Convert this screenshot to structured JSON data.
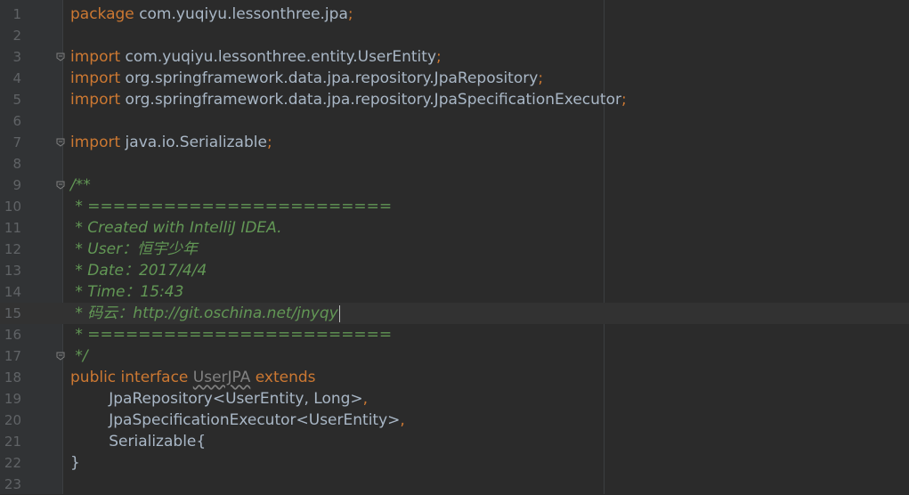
{
  "editor": {
    "lines": [
      {
        "n": "1",
        "parts": [
          [
            "kw",
            "package "
          ],
          [
            "pk",
            "com.yuqiyu.lessonthree.jpa"
          ],
          [
            "kw",
            ";"
          ]
        ]
      },
      {
        "n": "2",
        "parts": []
      },
      {
        "n": "3",
        "fold": true,
        "parts": [
          [
            "kw",
            "import "
          ],
          [
            "pk",
            "com.yuqiyu.lessonthree.entity.UserEntity"
          ],
          [
            "kw",
            ";"
          ]
        ]
      },
      {
        "n": "4",
        "parts": [
          [
            "kw",
            "import "
          ],
          [
            "pk",
            "org.springframework.data.jpa.repository.JpaRepository"
          ],
          [
            "kw",
            ";"
          ]
        ]
      },
      {
        "n": "5",
        "parts": [
          [
            "kw",
            "import "
          ],
          [
            "pk",
            "org.springframework.data.jpa.repository.JpaSpecificationExecutor"
          ],
          [
            "kw",
            ";"
          ]
        ]
      },
      {
        "n": "6",
        "parts": []
      },
      {
        "n": "7",
        "fold": true,
        "parts": [
          [
            "kw",
            "import "
          ],
          [
            "pk",
            "java.io.Serializable"
          ],
          [
            "kw",
            ";"
          ]
        ]
      },
      {
        "n": "8",
        "parts": []
      },
      {
        "n": "9",
        "fold": true,
        "parts": [
          [
            "cm",
            "/**"
          ]
        ]
      },
      {
        "n": "10",
        "parts": [
          [
            "cm",
            " * ========================"
          ]
        ]
      },
      {
        "n": "11",
        "parts": [
          [
            "cm",
            " * Created with IntelliJ IDEA."
          ]
        ]
      },
      {
        "n": "12",
        "parts": [
          [
            "cm",
            " * User：恒宇少年"
          ]
        ]
      },
      {
        "n": "13",
        "parts": [
          [
            "cm",
            " * Date：2017/4/4"
          ]
        ]
      },
      {
        "n": "14",
        "parts": [
          [
            "cm",
            " * Time：15:43"
          ]
        ]
      },
      {
        "n": "15",
        "current": true,
        "parts": [
          [
            "cm",
            " * 码云：http://git.oschina.net/jnyqy"
          ]
        ]
      },
      {
        "n": "16",
        "parts": [
          [
            "cm",
            " * ========================"
          ]
        ]
      },
      {
        "n": "17",
        "fold": true,
        "parts": [
          [
            "cm",
            " */"
          ]
        ]
      },
      {
        "n": "18",
        "parts": [
          [
            "kw",
            "public interface "
          ],
          [
            "dim squiggle",
            "UserJPA"
          ],
          [
            "kw",
            " extends"
          ]
        ]
      },
      {
        "n": "19",
        "parts": [
          [
            "pk",
            "        JpaRepository<UserEntity, Long>"
          ],
          [
            "kw",
            ","
          ]
        ]
      },
      {
        "n": "20",
        "parts": [
          [
            "pk",
            "        JpaSpecificationExecutor<UserEntity>"
          ],
          [
            "kw",
            ","
          ]
        ]
      },
      {
        "n": "21",
        "parts": [
          [
            "pk",
            "        Serializable{"
          ]
        ]
      },
      {
        "n": "22",
        "parts": [
          [
            "pk",
            "}"
          ]
        ]
      },
      {
        "n": "23",
        "parts": []
      }
    ]
  },
  "colors": {
    "background": "#2b2b2b",
    "keyword": "#cc7832",
    "comment": "#629755",
    "text": "#a9b7c6",
    "line_number": "#606366"
  }
}
